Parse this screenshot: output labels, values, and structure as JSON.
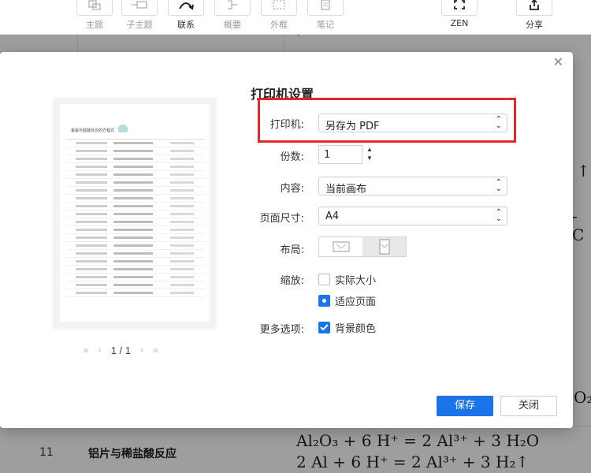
{
  "toolbar": {
    "items": [
      {
        "label": "主题",
        "icon": "topic-icon"
      },
      {
        "label": "子主题",
        "icon": "subtopic-icon"
      },
      {
        "label": "联系",
        "icon": "relation-icon"
      },
      {
        "label": "概要",
        "icon": "summary-icon"
      },
      {
        "label": "外框",
        "icon": "boundary-icon"
      },
      {
        "label": "笔记",
        "icon": "note-icon"
      }
    ],
    "zen_label": "ZEN",
    "share_label": "分享"
  },
  "background": {
    "row_number": "11",
    "row_name": "铝片与稀盐酸反应",
    "formula1": "Al₂O₃ + 6 H⁺  = 2 Al³⁺ + 3 H₂O",
    "formula2": "2 Al + 6 H⁺  = 2 Al³⁺ + 3 H₂↑",
    "frag_top": "  +    ",
    "frag_r1": "↑",
    "frag_r2": "- C",
    "frag_r3": "O₂"
  },
  "dialog": {
    "title": "打印机设置",
    "printer_label": "打印机:",
    "printer_value": "另存为 PDF",
    "copies_label": "份数:",
    "copies_value": "1",
    "content_label": "内容:",
    "content_value": "当前画布",
    "page_size_label": "页面尺寸:",
    "page_size_value": "A4",
    "layout_label": "布局:",
    "scale_label": "缩放:",
    "scale_actual": "实际大小",
    "scale_fit": "适应页面",
    "more_label": "更多选项:",
    "bg_color_label": "背景颜色",
    "save_label": "保存",
    "close_label": "关闭",
    "pager": "1 / 1",
    "preview_title": "金属与盐酸反应的方程式"
  },
  "colors": {
    "accent": "#1a73e8",
    "highlight": "#e3282a"
  }
}
